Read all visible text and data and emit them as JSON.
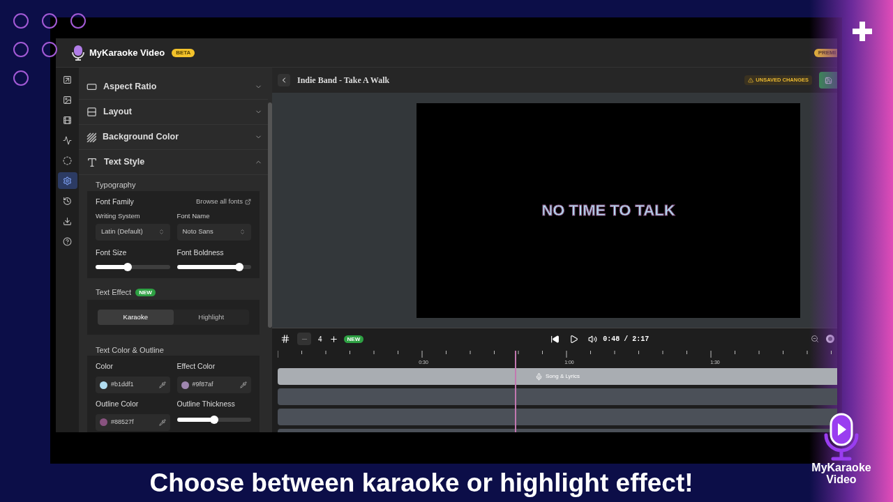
{
  "app": {
    "name": "MyKaraoke Video",
    "badge": "BETA",
    "plan_badge": "PREMI"
  },
  "rail": [
    {
      "selected": false
    },
    {
      "selected": false
    },
    {
      "selected": false
    },
    {
      "selected": false
    },
    {
      "selected": false
    },
    {
      "selected": true
    },
    {
      "selected": false
    },
    {
      "selected": false
    },
    {
      "selected": false
    }
  ],
  "sections": [
    {
      "title": "Aspect Ratio",
      "expanded": false
    },
    {
      "title": "Layout",
      "expanded": false
    },
    {
      "title": "Background Color",
      "expanded": false
    },
    {
      "title": "Text Style",
      "expanded": true
    }
  ],
  "typography": {
    "title": "Typography",
    "font_family_label": "Font Family",
    "browse_link": "Browse all fonts",
    "selects": [
      {
        "label": "Writing System",
        "value": "Latin (Default)"
      },
      {
        "label": "Font Name",
        "value": "Noto Sans"
      }
    ],
    "sliders": [
      {
        "label": "Font Size",
        "level": 0.43
      },
      {
        "label": "Font Boldness",
        "level": 0.84
      }
    ]
  },
  "text_effect": {
    "title": "Text Effect",
    "badge": "NEW",
    "options": [
      {
        "label": "Karaoke",
        "selected": true
      },
      {
        "label": "Highlight",
        "selected": false
      }
    ]
  },
  "text_color": {
    "title": "Text Color & Outline",
    "fields": [
      {
        "kind": "color",
        "label": "Color",
        "value": "#b1ddf1",
        "color": "#b1ddf1"
      },
      {
        "kind": "color",
        "label": "Effect Color",
        "value": "#9f87af",
        "color": "#9f87af"
      },
      {
        "kind": "color",
        "label": "Outline Color",
        "value": "#88527f",
        "color": "#88527f"
      },
      {
        "kind": "slider",
        "label": "Outline Thickness",
        "level": 0.5
      }
    ]
  },
  "editor": {
    "title": "Indie Band - Take A Walk",
    "status": "UNSAVED CHANGES"
  },
  "preview": {
    "lyric": "NO TIME TO TALK"
  },
  "timeline": {
    "track_count": "4",
    "badge": "NEW",
    "time": "0:48 / 2:17",
    "ruler_labels": [
      "0:30",
      "1:00",
      "1:30"
    ],
    "playhead": {
      "level": 0.42
    },
    "tracks": [
      {
        "kind": "lyrics",
        "label": "Song & Lyrics"
      },
      {
        "kind": "empty"
      },
      {
        "kind": "empty"
      },
      {
        "kind": "empty"
      }
    ]
  },
  "caption": "Choose between karaoke or highlight effect!",
  "brand_logo": {
    "lines": [
      "MyKaraoke",
      "Video"
    ]
  }
}
